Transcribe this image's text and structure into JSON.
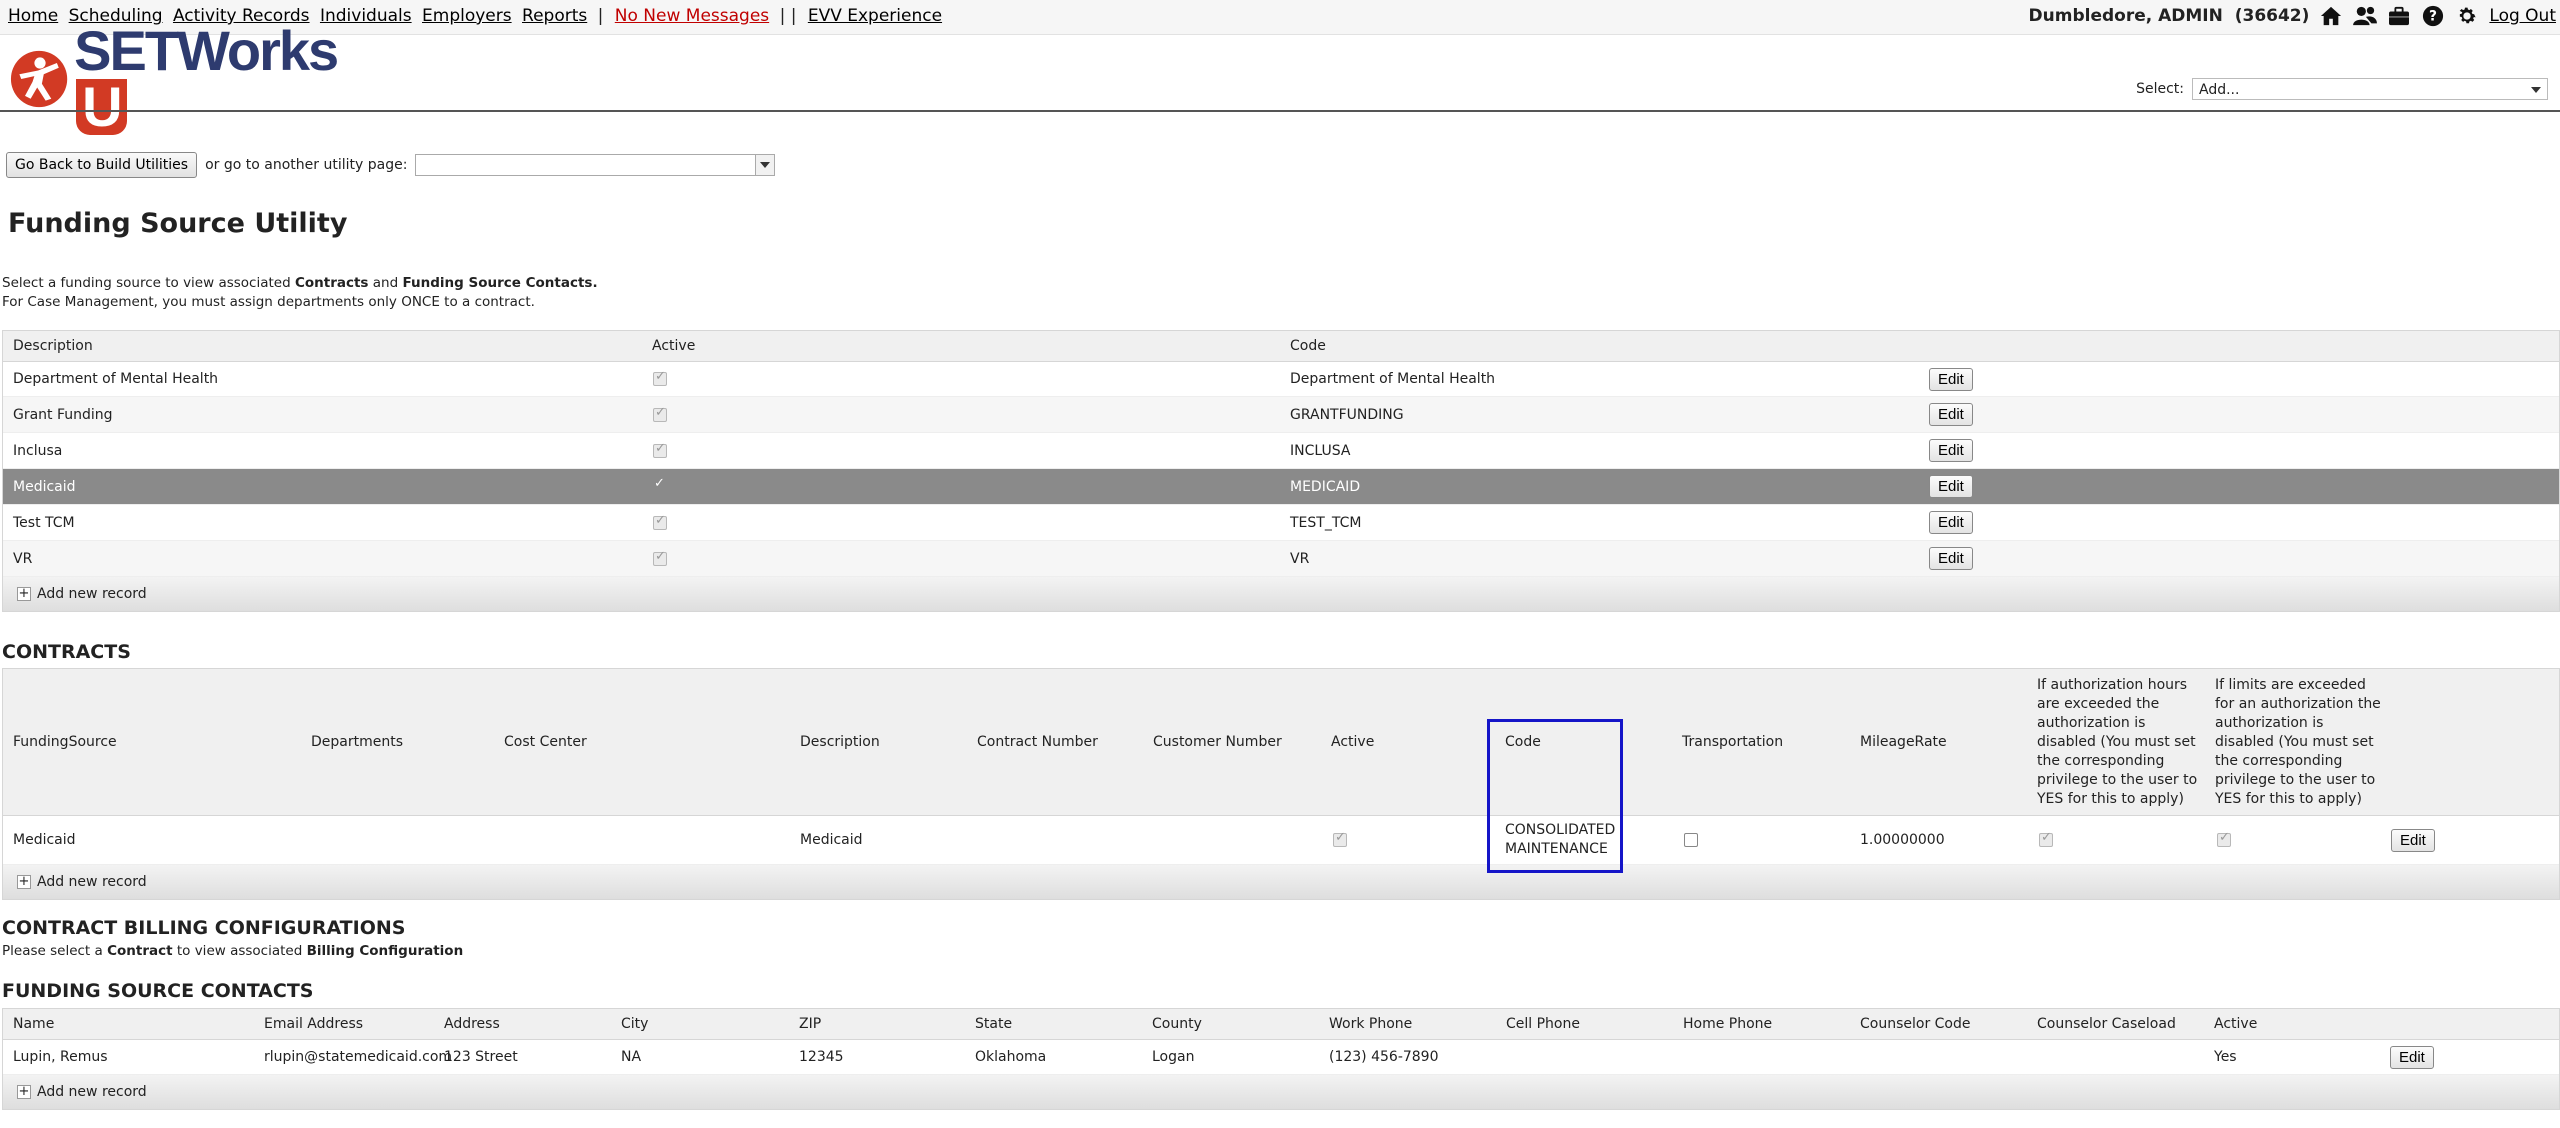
{
  "nav": {
    "items": [
      "Home",
      "Scheduling",
      "Activity Records",
      "Individuals",
      "Employers",
      "Reports"
    ],
    "sep1": "|",
    "messages": "No New Messages",
    "sep2": "| |",
    "evv": "EVV Experience"
  },
  "user": {
    "name": "Dumbledore, ADMIN",
    "id": "(36642)",
    "logout": "Log Out",
    "icons": [
      "home-icon",
      "users-icon",
      "briefcase-icon",
      "help-icon",
      "gear-icon"
    ]
  },
  "logo": {
    "text": "SETWorks",
    "u": "U"
  },
  "select": {
    "label": "Select:",
    "value": "Add..."
  },
  "util": {
    "back": "Go Back to Build Utilities",
    "goto": "or go to another utility page:"
  },
  "page_title": "Funding Source Utility",
  "intro": {
    "l1a": "Select a funding source to view associated ",
    "l1b": "Contracts",
    "l1c": " and ",
    "l1d": "Funding Source Contacts.",
    "l2": "For Case Management, you must assign departments only ONCE to a contract."
  },
  "funding": {
    "headers": [
      "Description",
      "Active",
      "Code"
    ],
    "rows": [
      {
        "description": "Department of Mental Health",
        "active": true,
        "code": "Department of Mental Health"
      },
      {
        "description": "Grant Funding",
        "active": true,
        "code": "GRANTFUNDING"
      },
      {
        "description": "Inclusa",
        "active": true,
        "code": "INCLUSA"
      },
      {
        "description": "Medicaid",
        "active": true,
        "code": "MEDICAID"
      },
      {
        "description": "Test TCM",
        "active": true,
        "code": "TEST_TCM"
      },
      {
        "description": "VR",
        "active": true,
        "code": "VR"
      }
    ],
    "selected_index": 3,
    "edit": "Edit",
    "add": "Add new record"
  },
  "contracts": {
    "title": "CONTRACTS",
    "headers": [
      "FundingSource",
      "Departments",
      "Cost Center",
      "Description",
      "Contract Number",
      "Customer Number",
      "Active",
      "Code",
      "Transportation",
      "MileageRate",
      "If authorization hours are exceeded the authorization is disabled (You must set the corresponding privilege to the user to YES for this to apply)",
      "If limits are exceeded for an authorization the authorization is disabled (You must set the corresponding privilege to the user to YES for this to apply)"
    ],
    "row": {
      "funding": "Medicaid",
      "departments": "",
      "cost_center": "",
      "description": "Medicaid",
      "contract_number": "",
      "customer_number": "",
      "active": true,
      "code": "CONSOLIDATED MAINTENANCE",
      "transportation": false,
      "mileage": "1.00000000",
      "hours_flag": true,
      "limits_flag": true
    },
    "edit": "Edit",
    "add": "Add new record"
  },
  "billing": {
    "title": "CONTRACT BILLING CONFIGURATIONS",
    "n1": "Please select a ",
    "n2": "Contract",
    "n3": " to view associated ",
    "n4": "Billing Configuration"
  },
  "contacts": {
    "title": "FUNDING SOURCE CONTACTS",
    "headers": [
      "Name",
      "Email Address",
      "Address",
      "City",
      "ZIP",
      "State",
      "County",
      "Work Phone",
      "Cell Phone",
      "Home Phone",
      "Counselor Code",
      "Counselor Caseload",
      "Active"
    ],
    "row": {
      "name": "Lupin, Remus",
      "email": "rlupin@statemedicaid.com",
      "address": "123 Street",
      "city": "NA",
      "zip": "12345",
      "state": "Oklahoma",
      "county": "Logan",
      "work": "(123) 456-7890",
      "cell": "",
      "home": "",
      "code": "",
      "caseload": "",
      "active": "Yes"
    },
    "edit": "Edit",
    "add": "Add new record"
  }
}
